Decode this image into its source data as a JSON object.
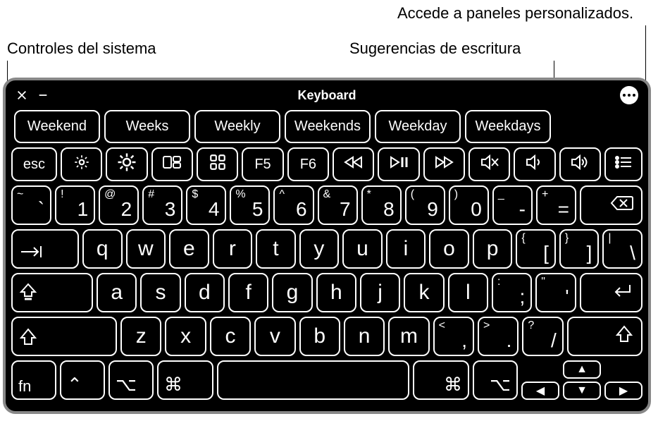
{
  "callouts": {
    "panels": "Accede a paneles personalizados.",
    "system": "Controles del sistema",
    "suggestions": "Sugerencias de escritura"
  },
  "window": {
    "title": "Keyboard"
  },
  "suggestions": [
    "Weekend",
    "Weeks",
    "Weekly",
    "Weekends",
    "Weekday",
    "Weekdays"
  ],
  "function_row": {
    "esc": "esc",
    "f5": "F5",
    "f6": "F6",
    "icons": {
      "bright_down": "brightness-down-icon",
      "bright_up": "brightness-up-icon",
      "mission": "mission-control-icon",
      "launchpad": "launchpad-icon",
      "rewind": "rewind-icon",
      "playpause": "play-pause-icon",
      "forward": "fast-forward-icon",
      "mute": "mute-icon",
      "vol_down": "volume-down-icon",
      "vol_up": "volume-up-icon",
      "panels": "panels-list-icon"
    }
  },
  "number_row": [
    {
      "top": "~",
      "main": "`"
    },
    {
      "top": "!",
      "main": "1"
    },
    {
      "top": "@",
      "main": "2"
    },
    {
      "top": "#",
      "main": "3"
    },
    {
      "top": "$",
      "main": "4"
    },
    {
      "top": "%",
      "main": "5"
    },
    {
      "top": "^",
      "main": "6"
    },
    {
      "top": "&",
      "main": "7"
    },
    {
      "top": "*",
      "main": "8"
    },
    {
      "top": "(",
      "main": "9"
    },
    {
      "top": ")",
      "main": "0"
    },
    {
      "top": "_",
      "main": "-"
    },
    {
      "top": "+",
      "main": "="
    }
  ],
  "qwerty_row": [
    "q",
    "w",
    "e",
    "r",
    "t",
    "y",
    "u",
    "i",
    "o",
    "p"
  ],
  "qwerty_brackets": [
    {
      "top": "{",
      "main": "["
    },
    {
      "top": "}",
      "main": "]"
    },
    {
      "top": "|",
      "main": "\\"
    }
  ],
  "asdf_row": [
    "a",
    "s",
    "d",
    "f",
    "g",
    "h",
    "j",
    "k",
    "l"
  ],
  "asdf_tail": [
    {
      "top": ":",
      "main": ";"
    },
    {
      "top": "\"",
      "main": "'"
    }
  ],
  "zxcv_row": [
    "z",
    "x",
    "c",
    "v",
    "b",
    "n",
    "m"
  ],
  "zxcv_tail": [
    {
      "top": "<",
      "main": ","
    },
    {
      "top": ">",
      "main": "."
    },
    {
      "top": "?",
      "main": "/"
    }
  ],
  "bottom": {
    "fn": "fn"
  }
}
